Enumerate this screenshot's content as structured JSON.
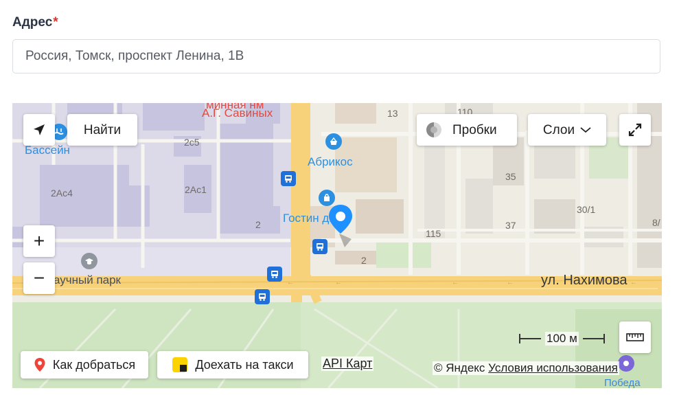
{
  "address": {
    "label": "Адрес",
    "required_mark": "*",
    "value": "Россия, Томск, проспект Ленина, 1В"
  },
  "map": {
    "controls": {
      "geolocation_icon": "arrow-navigation-icon",
      "find_label": "Найти",
      "traffic_label": "Пробки",
      "layers_label": "Слои",
      "fullscreen_icon": "expand-arrows-icon",
      "zoom_in_label": "+",
      "zoom_out_label": "−",
      "route_label": "Как добраться",
      "taxi_label": "Доехать на такси",
      "ruler_icon": "ruler-icon",
      "api_label": "API Карт"
    },
    "scale_label": "100 м",
    "copyright": {
      "prefix": "© Яндекс",
      "terms": "Условия использования"
    },
    "labels": {
      "savinykh_top": "минная нм",
      "savinykh": "А.Г. Савиных",
      "pool": "Бассейн",
      "abrikos": "Абрикос",
      "gostiny": "Гостин  двор",
      "street": "ул. Нахимова",
      "park": "аучный парк",
      "pobeda": "Победа",
      "n13": "13",
      "n110": "110",
      "n2c5": "2c5",
      "n2ac1": "2Ac1",
      "n2ac4": "2Ac4",
      "n2a": "2",
      "n2b": "2",
      "n35": "35",
      "n30_1": "30/1",
      "n37": "37",
      "n115": "115",
      "n8": "8/"
    },
    "colors": {
      "road": "#f7d27a",
      "block_purple": "#c7c4df",
      "park_green": "#d5e8c8",
      "poi_blue": "#2d8fe0",
      "pin": "#1e90ff"
    }
  }
}
